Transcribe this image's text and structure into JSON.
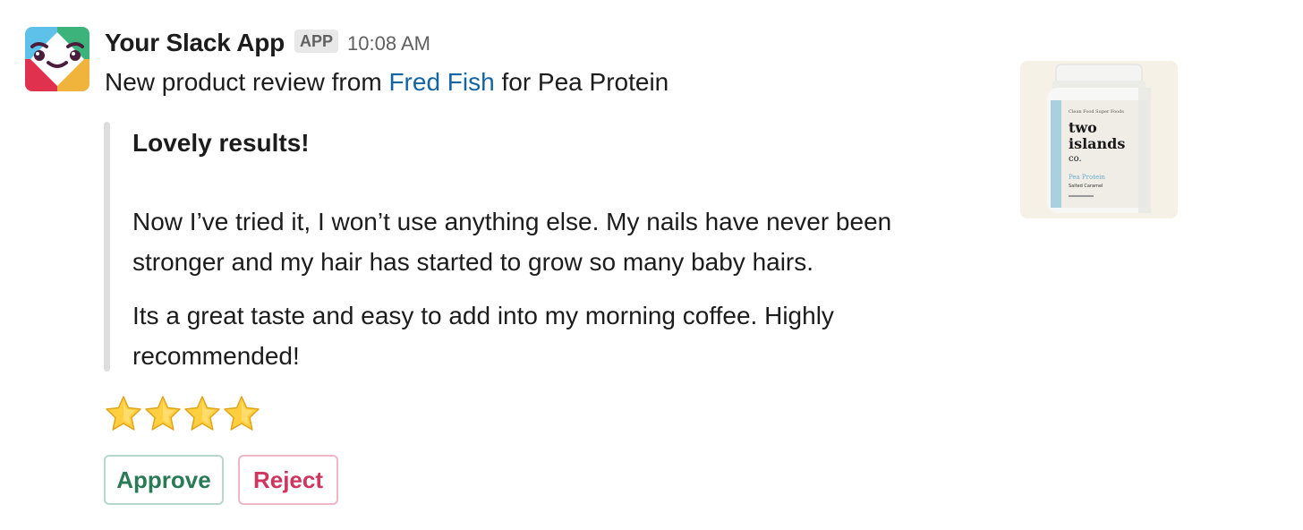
{
  "message": {
    "app_name": "Your Slack App",
    "app_badge": "APP",
    "timestamp": "10:08 AM",
    "intro": {
      "prefix": "New product review from ",
      "reviewer": "Fred Fish",
      "suffix": " for Pea Protein"
    },
    "review": {
      "title": "Lovely results!",
      "paragraph1": "Now I’ve tried it, I won’t use anything else. My nails have never been stronger and my hair has started to grow so many baby hairs.",
      "paragraph2": "Its a great taste and easy to add into my morning coffee. Highly recommended!"
    },
    "rating": {
      "stars": 4,
      "max": 4,
      "icon": "star-icon"
    },
    "product_image": {
      "brand_line1": "two",
      "brand_line2": "islands",
      "brand_line3": "co.",
      "top_text": "Clean Food Super Foods",
      "flavor_line1": "Pea Protein",
      "flavor_line2": "Salted Caramel"
    },
    "actions": {
      "approve_label": "Approve",
      "reject_label": "Reject"
    }
  },
  "colors": {
    "link": "#1264a3",
    "approve": "#2a7a56",
    "reject": "#d0355d",
    "quote_bar": "#dddddd",
    "badge_bg": "#e8e8e8"
  }
}
